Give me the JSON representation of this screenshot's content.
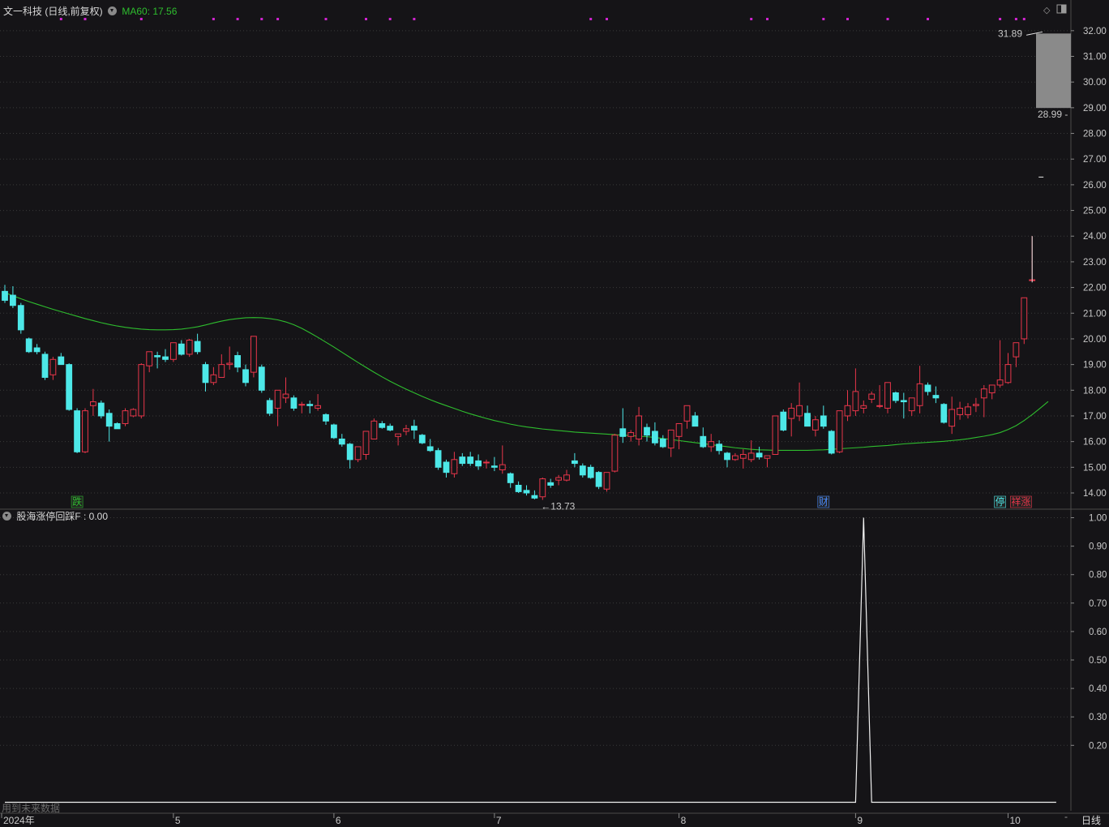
{
  "header": {
    "stock_title": "文一科技 (日线,前复权)",
    "ma_label": "MA60: 17.56",
    "indicator_label": "股海涨停回踩F : 0.00"
  },
  "footer": {
    "future_data_note": "用到未来数据",
    "period_label": "日线"
  },
  "colors": {
    "background": "#151417",
    "up": "#e8364a",
    "down": "#4de8e8",
    "ma": "#2ebd2e",
    "signal_dot": "#d024d0",
    "grid": "#3a3a3a",
    "axis_text": "#c8c8c8"
  },
  "chart_data": [
    {
      "type": "candlestick",
      "title": "文一科技 (日线,前复权)",
      "y_ticks": [
        14.0,
        15.0,
        16.0,
        17.0,
        18.0,
        19.0,
        20.0,
        21.0,
        22.0,
        23.0,
        24.0,
        25.0,
        26.0,
        27.0,
        28.0,
        29.0,
        30.0,
        31.0,
        32.0
      ],
      "ylim": [
        13.4,
        32.5
      ],
      "x_ticks": [
        {
          "label": "2024年",
          "index": 0
        },
        {
          "label": "5",
          "index": 21
        },
        {
          "label": "6",
          "index": 41
        },
        {
          "label": "7",
          "index": 61
        },
        {
          "label": "8",
          "index": 84
        },
        {
          "label": "9",
          "index": 106
        },
        {
          "label": "10",
          "index": 125
        }
      ],
      "annotations": {
        "low_marker": "←13.73",
        "range_high": "31.89",
        "range_low": "28.99",
        "tags": [
          {
            "text": "跌",
            "index": 9,
            "color": "#2ebd2e"
          },
          {
            "text": "财",
            "index": 102,
            "color": "#4a8cff"
          },
          {
            "text": "停",
            "index": 124,
            "color": "#4de8e8"
          },
          {
            "text": "祥涨",
            "index": 126,
            "color": "#e8364a"
          }
        ]
      },
      "signal_dot_indices": [
        7,
        10,
        17,
        26,
        29,
        32,
        34,
        40,
        45,
        48,
        51,
        73,
        75,
        93,
        95,
        102,
        105,
        110,
        115,
        124,
        126,
        127
      ],
      "series": [
        {
          "name": "K线",
          "ohlc": [
            [
              21.85,
              22.1,
              21.4,
              21.5
            ],
            [
              21.7,
              22.05,
              21.2,
              21.3
            ],
            [
              21.3,
              21.4,
              20.2,
              20.35
            ],
            [
              20.0,
              20.05,
              19.45,
              19.5
            ],
            [
              19.65,
              19.8,
              19.4,
              19.5
            ],
            [
              19.4,
              19.5,
              18.4,
              18.5
            ],
            [
              18.6,
              19.3,
              18.4,
              19.2
            ],
            [
              19.3,
              19.45,
              19.0,
              19.0
            ],
            [
              19.0,
              19.05,
              17.2,
              17.25
            ],
            [
              17.2,
              17.3,
              15.55,
              15.6
            ],
            [
              15.6,
              17.3,
              15.55,
              17.2
            ],
            [
              17.4,
              18.05,
              17.0,
              17.55
            ],
            [
              17.5,
              17.6,
              16.9,
              17.0
            ],
            [
              17.1,
              17.25,
              16.0,
              16.6
            ],
            [
              16.7,
              16.75,
              16.5,
              16.5
            ],
            [
              16.7,
              17.3,
              16.6,
              17.2
            ],
            [
              17.0,
              17.3,
              16.95,
              17.25
            ],
            [
              17.0,
              19.05,
              16.9,
              19.0
            ],
            [
              18.95,
              19.5,
              18.7,
              19.5
            ],
            [
              19.35,
              19.5,
              18.85,
              19.3
            ],
            [
              19.3,
              19.6,
              19.1,
              19.2
            ],
            [
              19.2,
              19.85,
              19.1,
              19.85
            ],
            [
              19.8,
              19.95,
              19.35,
              19.4
            ],
            [
              19.4,
              20.0,
              19.3,
              19.95
            ],
            [
              19.9,
              20.2,
              19.4,
              19.5
            ],
            [
              19.0,
              19.1,
              17.95,
              18.3
            ],
            [
              18.3,
              18.9,
              18.2,
              18.6
            ],
            [
              18.5,
              19.4,
              18.5,
              19.0
            ],
            [
              19.0,
              19.7,
              18.8,
              19.05
            ],
            [
              19.35,
              19.5,
              18.7,
              18.9
            ],
            [
              18.8,
              19.0,
              18.15,
              18.3
            ],
            [
              18.7,
              20.1,
              18.5,
              20.1
            ],
            [
              18.9,
              19.0,
              17.9,
              18.0
            ],
            [
              17.6,
              17.7,
              17.0,
              17.1
            ],
            [
              17.3,
              18.0,
              16.6,
              18.0
            ],
            [
              17.7,
              18.5,
              17.5,
              17.85
            ],
            [
              17.7,
              17.8,
              17.2,
              17.3
            ],
            [
              17.45,
              17.55,
              17.1,
              17.45
            ],
            [
              17.45,
              17.6,
              17.1,
              17.4
            ],
            [
              17.3,
              17.85,
              17.2,
              17.4
            ],
            [
              17.05,
              17.1,
              16.65,
              16.8
            ],
            [
              16.65,
              16.7,
              16.1,
              16.15
            ],
            [
              16.1,
              16.3,
              15.8,
              15.9
            ],
            [
              15.9,
              15.95,
              14.95,
              15.3
            ],
            [
              15.3,
              15.8,
              15.2,
              15.8
            ],
            [
              15.5,
              16.2,
              15.3,
              16.4
            ],
            [
              16.1,
              16.9,
              16.1,
              16.8
            ],
            [
              16.7,
              16.8,
              16.5,
              16.55
            ],
            [
              16.6,
              16.7,
              16.4,
              16.45
            ],
            [
              16.2,
              16.3,
              15.85,
              16.3
            ],
            [
              16.4,
              16.65,
              16.25,
              16.5
            ],
            [
              16.6,
              16.85,
              16.1,
              16.45
            ],
            [
              16.25,
              16.3,
              15.9,
              15.95
            ],
            [
              15.8,
              16.1,
              15.6,
              15.65
            ],
            [
              15.65,
              15.75,
              14.9,
              15.0
            ],
            [
              15.2,
              15.3,
              14.6,
              14.8
            ],
            [
              14.75,
              15.6,
              14.6,
              15.3
            ],
            [
              15.4,
              15.55,
              15.05,
              15.15
            ],
            [
              15.4,
              15.6,
              15.05,
              15.15
            ],
            [
              15.25,
              15.5,
              14.9,
              15.05
            ],
            [
              15.2,
              15.3,
              14.95,
              15.2
            ],
            [
              15.05,
              15.4,
              14.85,
              15.0
            ],
            [
              14.9,
              15.85,
              14.75,
              15.1
            ],
            [
              14.75,
              14.8,
              14.2,
              14.4
            ],
            [
              14.3,
              14.45,
              14.0,
              14.05
            ],
            [
              14.1,
              14.3,
              13.9,
              14.0
            ],
            [
              13.9,
              14.1,
              13.75,
              13.8
            ],
            [
              13.85,
              14.6,
              13.73,
              14.55
            ],
            [
              14.4,
              14.55,
              14.2,
              14.3
            ],
            [
              14.5,
              14.7,
              14.3,
              14.6
            ],
            [
              14.5,
              14.9,
              14.45,
              14.7
            ],
            [
              15.25,
              15.55,
              15.0,
              15.15
            ],
            [
              15.05,
              15.15,
              14.6,
              14.7
            ],
            [
              15.0,
              15.1,
              14.55,
              14.6
            ],
            [
              14.8,
              14.85,
              14.15,
              14.25
            ],
            [
              14.15,
              14.25,
              14.05,
              14.8
            ],
            [
              14.85,
              16.3,
              14.8,
              16.25
            ],
            [
              16.5,
              17.3,
              15.95,
              16.2
            ],
            [
              16.2,
              16.45,
              16.0,
              16.35
            ],
            [
              16.1,
              17.35,
              15.85,
              17.0
            ],
            [
              16.55,
              16.7,
              16.0,
              16.25
            ],
            [
              16.4,
              16.75,
              15.85,
              15.95
            ],
            [
              16.1,
              16.25,
              15.75,
              15.8
            ],
            [
              15.75,
              16.3,
              15.4,
              16.45
            ],
            [
              16.2,
              16.7,
              15.7,
              16.7
            ],
            [
              16.8,
              17.4,
              16.5,
              17.4
            ],
            [
              17.0,
              17.15,
              16.6,
              16.6
            ],
            [
              16.2,
              16.55,
              15.75,
              15.8
            ],
            [
              15.8,
              16.3,
              15.6,
              16.0
            ],
            [
              15.9,
              16.05,
              15.5,
              15.65
            ],
            [
              15.55,
              15.6,
              15.0,
              15.3
            ],
            [
              15.3,
              15.55,
              15.25,
              15.45
            ],
            [
              15.35,
              15.7,
              14.95,
              15.5
            ],
            [
              15.3,
              16.05,
              15.2,
              15.55
            ],
            [
              15.55,
              15.8,
              15.3,
              15.4
            ],
            [
              15.35,
              15.45,
              15.0,
              15.45
            ],
            [
              15.5,
              17.0,
              15.5,
              17.0
            ],
            [
              17.15,
              17.25,
              16.4,
              16.45
            ],
            [
              16.9,
              17.5,
              16.2,
              17.3
            ],
            [
              17.0,
              18.3,
              16.8,
              17.4
            ],
            [
              17.1,
              17.4,
              16.6,
              16.6
            ],
            [
              16.45,
              17.0,
              16.2,
              16.85
            ],
            [
              17.0,
              17.4,
              16.5,
              16.6
            ],
            [
              16.4,
              16.45,
              15.5,
              15.55
            ],
            [
              15.6,
              17.2,
              15.55,
              17.2
            ],
            [
              17.0,
              18.0,
              16.8,
              17.4
            ],
            [
              17.2,
              18.85,
              17.0,
              17.95
            ],
            [
              17.3,
              17.6,
              17.1,
              17.4
            ],
            [
              17.65,
              17.95,
              17.5,
              17.85
            ],
            [
              17.4,
              18.2,
              17.3,
              17.4
            ],
            [
              17.3,
              18.3,
              17.1,
              18.3
            ],
            [
              17.9,
              17.95,
              17.5,
              17.6
            ],
            [
              17.6,
              17.9,
              16.9,
              17.55
            ],
            [
              17.2,
              17.65,
              17.0,
              17.7
            ],
            [
              17.4,
              18.95,
              17.1,
              18.25
            ],
            [
              18.2,
              18.3,
              17.8,
              17.95
            ],
            [
              17.8,
              18.15,
              17.5,
              17.7
            ],
            [
              17.45,
              17.5,
              16.7,
              16.75
            ],
            [
              16.6,
              17.75,
              16.3,
              17.25
            ],
            [
              17.05,
              17.55,
              16.85,
              17.3
            ],
            [
              17.05,
              17.5,
              16.9,
              17.35
            ],
            [
              17.4,
              17.7,
              17.15,
              17.45
            ],
            [
              17.7,
              18.2,
              16.95,
              18.05
            ],
            [
              17.9,
              18.2,
              17.65,
              18.2
            ],
            [
              18.2,
              19.95,
              18.1,
              18.4
            ],
            [
              18.3,
              19.45,
              18.25,
              19.0
            ],
            [
              19.3,
              19.6,
              18.9,
              19.85
            ],
            [
              20.0,
              21.6,
              19.8,
              21.6
            ],
            [
              22.3,
              24.0,
              22.3,
              22.3
            ]
          ]
        },
        {
          "name": "MA60",
          "values": [
            21.8,
            21.68,
            21.56,
            21.45,
            21.35,
            21.25,
            21.15,
            21.06,
            20.97,
            20.88,
            20.79,
            20.71,
            20.63,
            20.56,
            20.5,
            20.45,
            20.41,
            20.38,
            20.36,
            20.35,
            20.35,
            20.36,
            20.38,
            20.42,
            20.47,
            20.54,
            20.62,
            20.69,
            20.75,
            20.79,
            20.82,
            20.83,
            20.82,
            20.79,
            20.74,
            20.66,
            20.55,
            20.41,
            20.24,
            20.06,
            19.87,
            19.68,
            19.48,
            19.28,
            19.08,
            18.89,
            18.7,
            18.52,
            18.35,
            18.19,
            18.04,
            17.9,
            17.76,
            17.63,
            17.51,
            17.4,
            17.29,
            17.18,
            17.08,
            16.99,
            16.9,
            16.82,
            16.75,
            16.68,
            16.62,
            16.57,
            16.53,
            16.49,
            16.46,
            16.43,
            16.4,
            16.37,
            16.35,
            16.33,
            16.31,
            16.29,
            16.27,
            16.25,
            16.23,
            16.21,
            16.19,
            16.16,
            16.12,
            16.08,
            16.04,
            16.0,
            15.96,
            15.92,
            15.88,
            15.84,
            15.8,
            15.76,
            15.73,
            15.7,
            15.68,
            15.67,
            15.66,
            15.66,
            15.66,
            15.66,
            15.66,
            15.67,
            15.68,
            15.7,
            15.72,
            15.74,
            15.76,
            15.78,
            15.81,
            15.83,
            15.85,
            15.88,
            15.91,
            15.93,
            15.95,
            15.97,
            15.99,
            16.01,
            16.04,
            16.07,
            16.11,
            16.16,
            16.21,
            16.27,
            16.35,
            16.47,
            16.62,
            16.82,
            17.05,
            17.3,
            17.56
          ]
        }
      ]
    },
    {
      "type": "line",
      "title": "股海涨停回踩F : 0.00",
      "series": [
        {
          "name": "股海涨停回踩F",
          "spike_index": 107,
          "spike_value": 1.0
        }
      ],
      "y_ticks": [
        0.2,
        0.3,
        0.4,
        0.5,
        0.6,
        0.7,
        0.8,
        0.9,
        1.0
      ],
      "ylim": [
        -0.03,
        1.03
      ]
    }
  ]
}
